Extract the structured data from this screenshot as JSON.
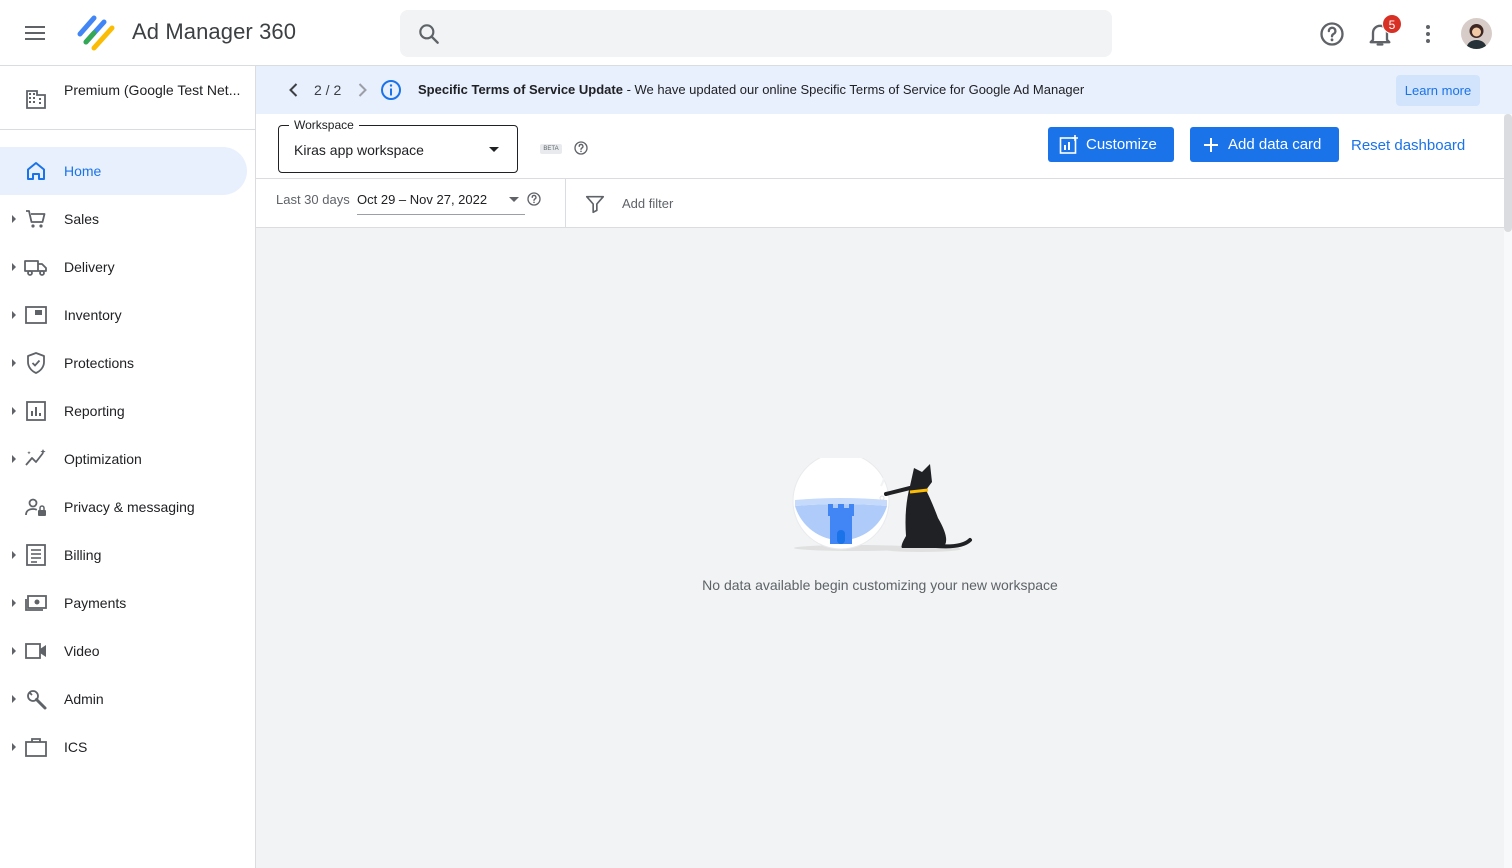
{
  "app": {
    "title": "Ad Manager 360"
  },
  "search": {
    "placeholder": ""
  },
  "header": {
    "notifications_count": "5"
  },
  "network": {
    "label": "Premium (Google Test Net..."
  },
  "sidebar": {
    "items": [
      {
        "label": "Home",
        "icon": "home-icon",
        "active": true
      },
      {
        "label": "Sales",
        "icon": "cart-icon"
      },
      {
        "label": "Delivery",
        "icon": "truck-icon"
      },
      {
        "label": "Inventory",
        "icon": "inventory-icon"
      },
      {
        "label": "Protections",
        "icon": "shield-icon"
      },
      {
        "label": "Reporting",
        "icon": "bar-chart-icon"
      },
      {
        "label": "Optimization",
        "icon": "sparkline-icon"
      },
      {
        "label": "Privacy & messaging",
        "icon": "person-lock-icon"
      },
      {
        "label": "Billing",
        "icon": "billing-icon"
      },
      {
        "label": "Payments",
        "icon": "payments-icon"
      },
      {
        "label": "Video",
        "icon": "video-icon"
      },
      {
        "label": "Admin",
        "icon": "wrench-icon"
      },
      {
        "label": "ICS",
        "icon": "briefcase-icon"
      }
    ]
  },
  "banner": {
    "pager": "2 / 2",
    "title": "Specific Terms of Service Update",
    "message": " - We have updated our online Specific Terms of Service for Google Ad Manager",
    "learn_more": "Learn more"
  },
  "toolbar": {
    "workspace_legend": "Workspace",
    "workspace_value": "Kiras app workspace",
    "beta_label": "BETA",
    "customize_label": "Customize",
    "add_data_card_label": "Add data card",
    "reset_label": "Reset dashboard"
  },
  "filters": {
    "range_label": "Last 30 days",
    "range_value": "Oct 29 – Nov 27, 2022",
    "add_filter": "Add filter"
  },
  "main": {
    "empty_message": "No data available begin customizing your new workspace"
  },
  "colors": {
    "accent": "#1a73e8",
    "active_bg": "#e8f0fe",
    "badge": "#d93025"
  }
}
